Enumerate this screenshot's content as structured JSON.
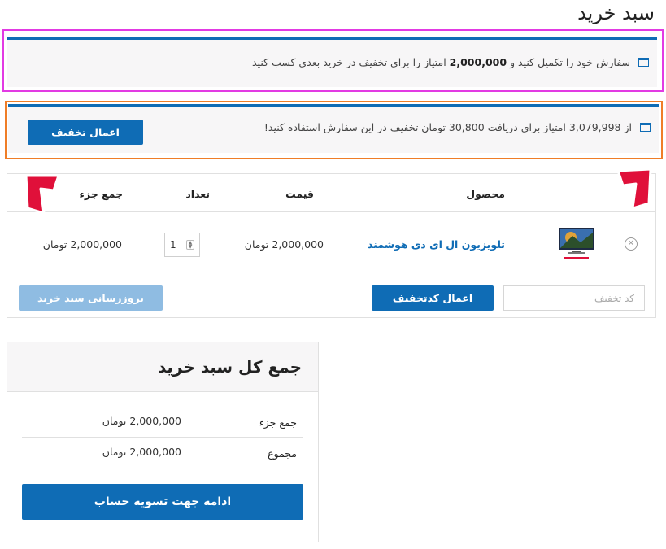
{
  "page": {
    "title": "سبد خرید"
  },
  "notices": {
    "earn_points": {
      "text_before": "سفارش خود را تکمیل کنید و",
      "points": "2,000,000",
      "text_after": "امتیاز را برای تخفیف در خرید بعدی کسب کنید"
    },
    "redeem_points": {
      "text": "از 3,079,998 امتیاز برای دریافت 30,800 تومان تخفیف در این سفارش استفاده کنید!",
      "button_label": "اعمال تخفیف"
    }
  },
  "cart": {
    "headers": {
      "product": "محصول",
      "price": "قیمت",
      "quantity": "تعداد",
      "subtotal": "جمع جزء"
    },
    "items": [
      {
        "name": "تلویزیون ال ای دی هوشمند",
        "price": "2,000,000 تومان",
        "quantity": "1",
        "subtotal": "2,000,000 تومان",
        "remove_icon": "close-circle-icon"
      }
    ],
    "coupon_placeholder": "کد تخفیف",
    "apply_coupon_label": "اعمال کدتخفیف",
    "update_cart_label": "بروزرسانی سبد خرید"
  },
  "totals": {
    "title": "جمع کل سبد خرید",
    "subtotal_label": "جمع جزء",
    "subtotal_value": "2,000,000 تومان",
    "total_label": "مجموع",
    "total_value": "2,000,000 تومان",
    "checkout_label": "ادامه جهت تسویه حساب"
  },
  "colors": {
    "accent": "#0f6cb5",
    "accent_disabled": "#8fbce2",
    "highlight_pink": "#e23ae3",
    "highlight_orange": "#ef7d27",
    "arrow_red": "#e0103a"
  }
}
